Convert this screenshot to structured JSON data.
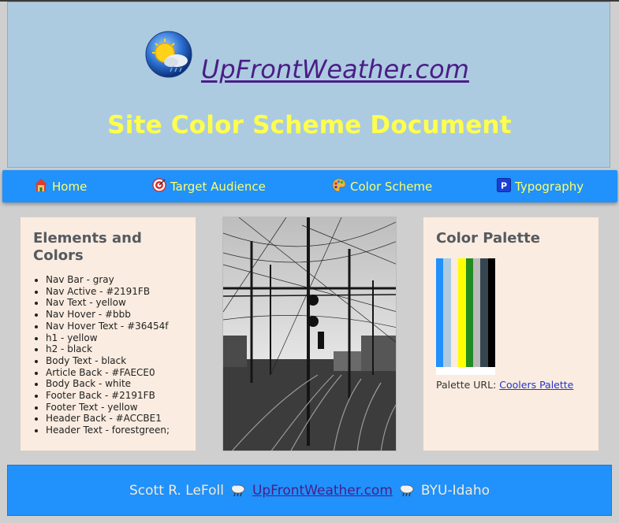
{
  "header": {
    "site_link": "UpFrontWeather.com",
    "title": "Site Color Scheme Document",
    "logo_icon": "weather-sun-cloud-icon"
  },
  "nav": {
    "items": [
      {
        "label": "Home",
        "icon": "home-icon"
      },
      {
        "label": "Target Audience",
        "icon": "target-icon"
      },
      {
        "label": "Color Scheme",
        "icon": "palette-icon"
      },
      {
        "label": "Typography",
        "icon": "p-icon"
      }
    ]
  },
  "elements_card": {
    "title": "Elements and Colors",
    "items": [
      "Nav Bar - gray",
      "Nav Active - #2191FB",
      "Nav Text - yellow",
      "Nav Hover - #bbb",
      "Nav Hover Text - #36454f",
      "h1 - yellow",
      "h2 - black",
      "Body Text - black",
      "Article Back - #FAECE0",
      "Body Back - white",
      "Footer Back - #2191FB",
      "Footer Text - yellow",
      "Header Back - #ACCBE1",
      "Header Text - forestgreen;"
    ]
  },
  "palette_card": {
    "title": "Color Palette",
    "swatches": [
      "#2191FB",
      "#ACCBE1",
      "#FAECE0",
      "#FFFF00",
      "#228B22",
      "#BBBBBB",
      "#36454F",
      "#000000"
    ],
    "url_label": "Palette URL:",
    "url_link": "Coolers Palette"
  },
  "footer": {
    "author": "Scott R. LeFoll",
    "site_link": "UpFrontWeather.com",
    "school": "BYU-Idaho",
    "separator_icon": "rain-cloud-icon"
  },
  "colors": {
    "nav_background": "#2191FB",
    "nav_text": "#FFFF66",
    "header_background": "#ACCBE1",
    "article_background": "#FAECE0"
  }
}
